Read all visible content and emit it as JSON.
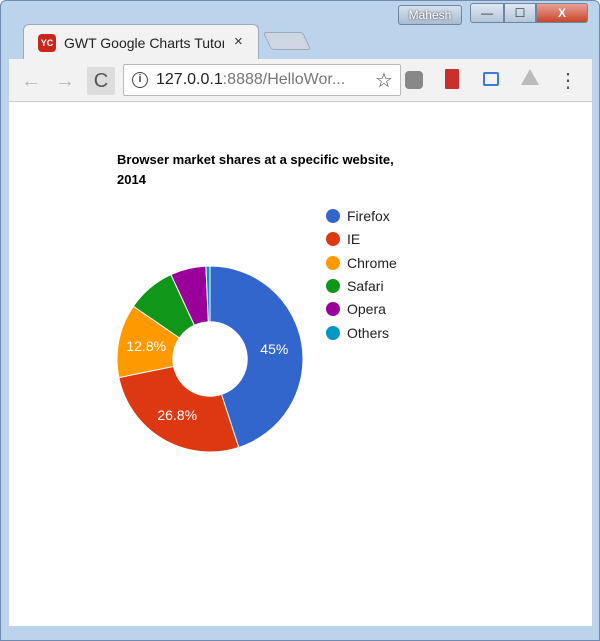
{
  "window": {
    "profile": "Mahesh",
    "minimize": "—",
    "maximize": "☐",
    "close": "X"
  },
  "tab": {
    "title": "GWT Google Charts Tutorial",
    "close": "×",
    "favicon": "YC"
  },
  "toolbar": {
    "back": "←",
    "forward": "→",
    "reload": "C",
    "url_host": "127.0.0.1",
    "url_rest": ":8888/HelloWor...",
    "info": "i",
    "star": "☆",
    "menu": "⋮"
  },
  "chart_data": {
    "type": "pie",
    "title": "Browser market shares at a specific website, 2014",
    "pie_hole": 0.4,
    "legend": "right",
    "categories": [
      "Firefox",
      "IE",
      "Chrome",
      "Safari",
      "Opera",
      "Others"
    ],
    "values": [
      45.0,
      26.8,
      12.8,
      8.5,
      6.2,
      0.7
    ],
    "slice_labels": [
      "45%",
      "26.8%",
      "12.8%",
      "",
      "",
      ""
    ],
    "colors": [
      "#3366cc",
      "#dc3912",
      "#ff9900",
      "#109618",
      "#990099",
      "#0099c6"
    ]
  }
}
